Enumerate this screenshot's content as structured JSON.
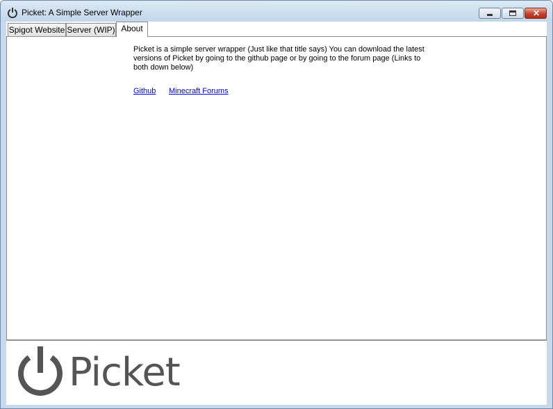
{
  "window": {
    "title": "Picket: A Simple Server Wrapper",
    "accent": "#c7d9ea"
  },
  "tabs": [
    {
      "label": "Spigot Website",
      "active": false
    },
    {
      "label": "Server (WIP)",
      "active": false
    },
    {
      "label": "About",
      "active": true
    }
  ],
  "about": {
    "text": "Picket is a simple server wrapper (Just like that title says) You can download the latest versions of Picket by going to the github page or by going to the forum page (Links to both down below)",
    "links": [
      {
        "label": "Github"
      },
      {
        "label": "Minecraft Forums"
      }
    ]
  },
  "logo": {
    "text": "Picket",
    "icon": "power-icon",
    "color": "#555555"
  }
}
